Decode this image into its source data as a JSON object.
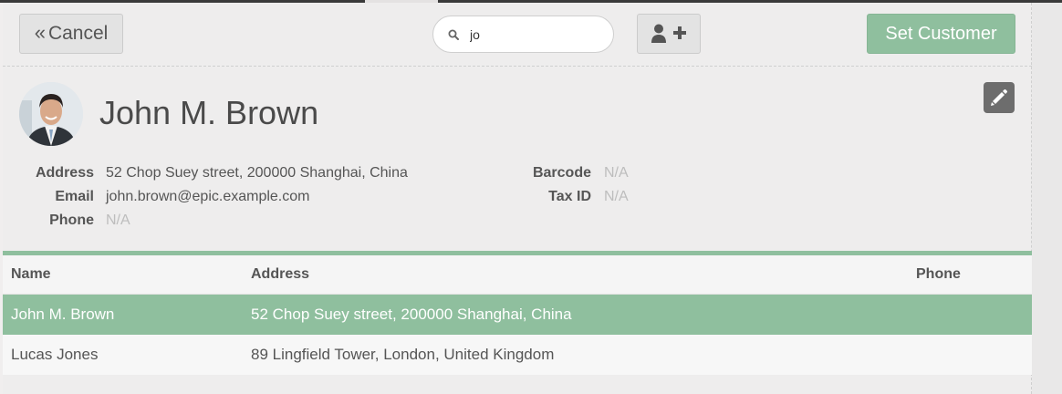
{
  "topbar": {
    "cancel_label": "Cancel",
    "search_value": "jo",
    "set_customer_label": "Set Customer"
  },
  "customer": {
    "name": "John M. Brown",
    "fields": {
      "address_label": "Address",
      "address_value": "52 Chop Suey street, 200000 Shanghai, China",
      "email_label": "Email",
      "email_value": "john.brown@epic.example.com",
      "phone_label": "Phone",
      "phone_value": "N/A",
      "barcode_label": "Barcode",
      "barcode_value": "N/A",
      "taxid_label": "Tax ID",
      "taxid_value": "N/A"
    }
  },
  "table": {
    "headers": [
      "Name",
      "Address",
      "Phone"
    ],
    "rows": [
      {
        "name": "John M. Brown",
        "address": "52 Chop Suey street, 200000 Shanghai, China",
        "phone": "",
        "selected": true
      },
      {
        "name": "Lucas Jones",
        "address": "89 Lingfield Tower, London, United Kingdom",
        "phone": "",
        "selected": false
      }
    ]
  },
  "colors": {
    "accent_green": "#8fbf9e",
    "edit_button": "#6d6d6d"
  },
  "icons": {
    "cancel": "double-chevron-left-icon",
    "search": "search-icon",
    "add_customer": "user-plus-icon",
    "edit": "pencil-icon",
    "avatar": "customer-avatar"
  }
}
